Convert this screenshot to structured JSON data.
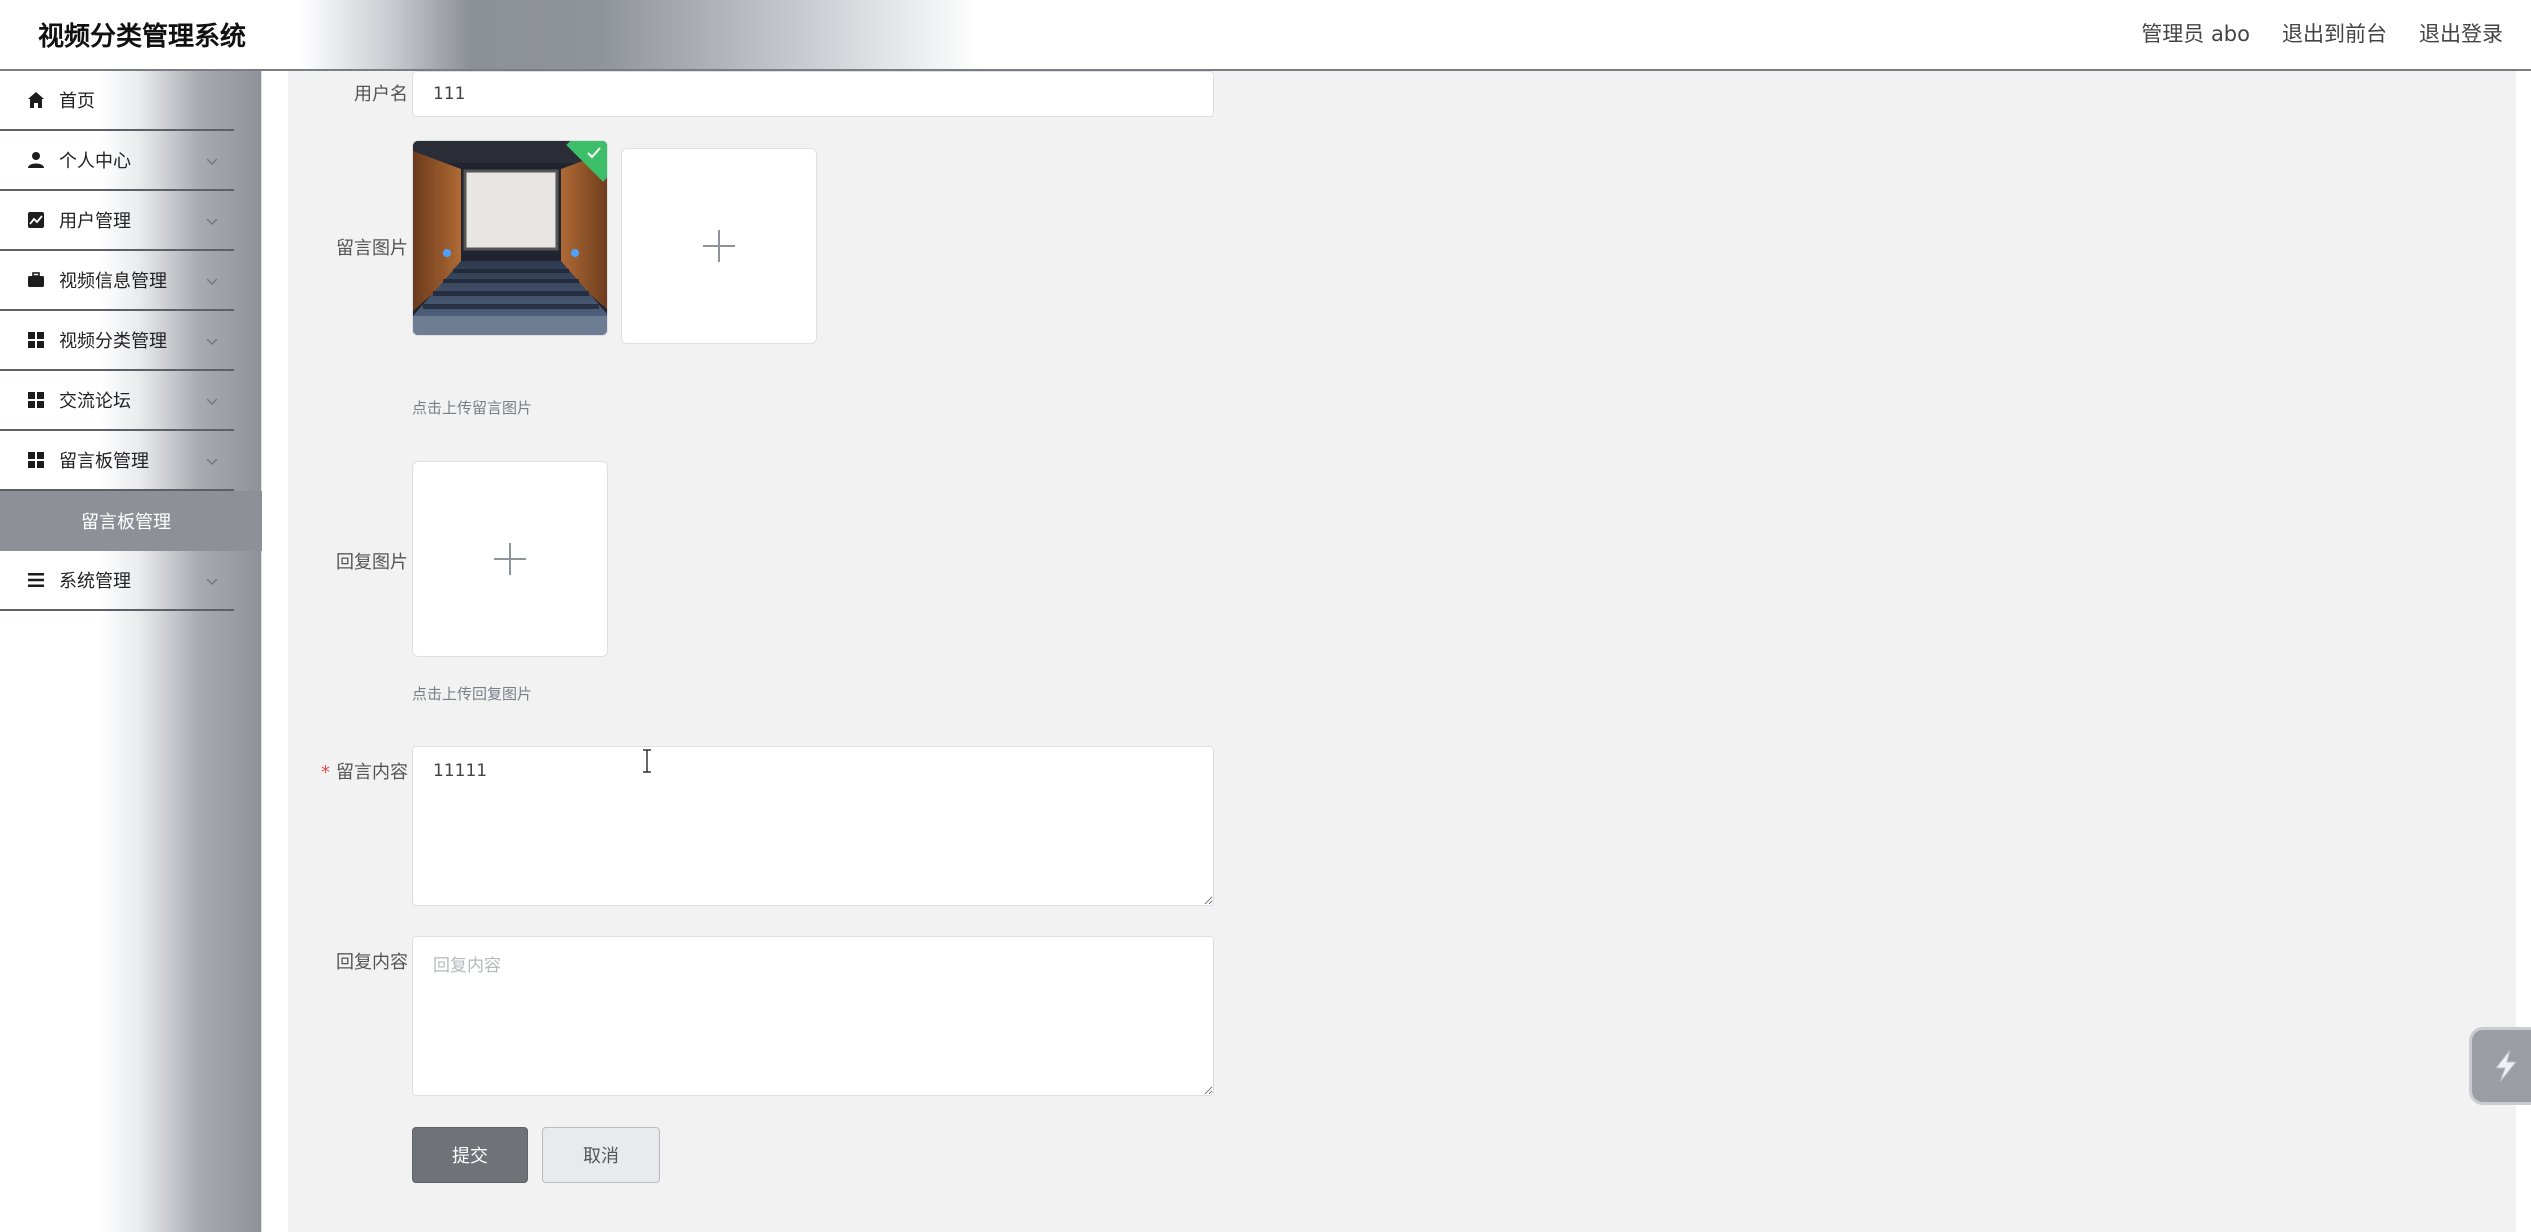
{
  "header": {
    "app_title": "视频分类管理系统",
    "user_label": "管理员 abo",
    "to_frontend": "退出到前台",
    "logout": "退出登录"
  },
  "sidebar": {
    "items": [
      {
        "label": "首页",
        "icon": "home-icon",
        "has_chevron": false
      },
      {
        "label": "个人中心",
        "icon": "user-icon",
        "has_chevron": true
      },
      {
        "label": "用户管理",
        "icon": "chart-icon",
        "has_chevron": true
      },
      {
        "label": "视频信息管理",
        "icon": "briefcase-icon",
        "has_chevron": true
      },
      {
        "label": "视频分类管理",
        "icon": "grid-icon",
        "has_chevron": true
      },
      {
        "label": "交流论坛",
        "icon": "grid-icon",
        "has_chevron": true
      },
      {
        "label": "留言板管理",
        "icon": "grid-icon",
        "has_chevron": true
      },
      {
        "label": "系统管理",
        "icon": "menu-icon",
        "has_chevron": true
      }
    ],
    "active_subitem": "留言板管理"
  },
  "form": {
    "username_label": "用户名",
    "username_value": "111",
    "message_image_label": "留言图片",
    "message_image_tip": "点击上传留言图片",
    "reply_image_label": "回复图片",
    "reply_image_tip": "点击上传回复图片",
    "content_label": "留言内容",
    "content_required_mark": "*",
    "content_value": "11111",
    "reply_label": "回复内容",
    "reply_placeholder": "回复内容",
    "submit_label": "提交",
    "cancel_label": "取消"
  },
  "colors": {
    "accent": "#6f7277",
    "success": "#3dbf6a",
    "required": "#e84a4a"
  }
}
